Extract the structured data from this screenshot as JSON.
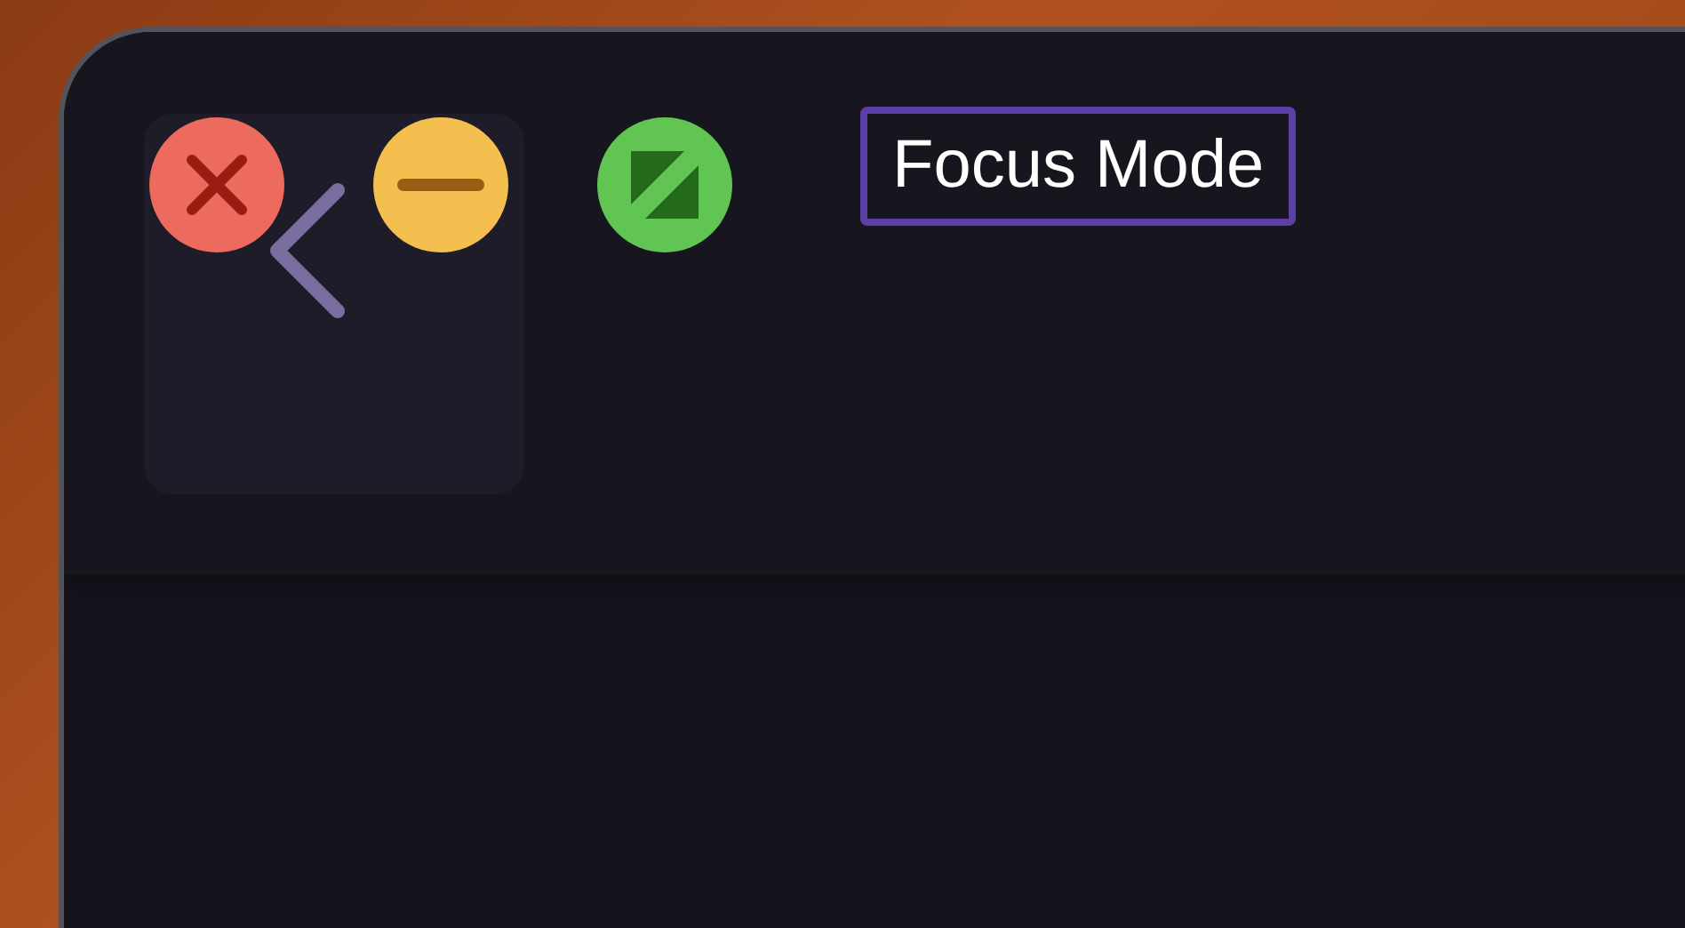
{
  "window": {
    "title": "Focus Mode",
    "title_focused": true
  }
}
